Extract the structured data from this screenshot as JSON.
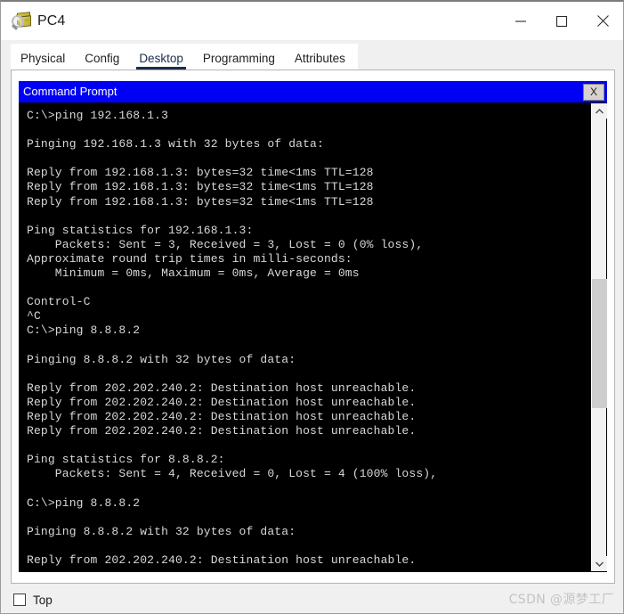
{
  "window": {
    "title": "PC4",
    "icon": "packet-tracer-magnifier-icon",
    "controls": {
      "minimize": "minimize-icon",
      "maximize": "maximize-icon",
      "close": "close-icon"
    }
  },
  "tabs": [
    {
      "label": "Physical",
      "active": false
    },
    {
      "label": "Config",
      "active": false
    },
    {
      "label": "Desktop",
      "active": true
    },
    {
      "label": "Programming",
      "active": false
    },
    {
      "label": "Attributes",
      "active": false
    }
  ],
  "command_prompt": {
    "title": "Command Prompt",
    "close_label": "X",
    "title_bar_color": "#0000f5",
    "background_color": "#000000",
    "text_color": "#d8d8d8",
    "lines": [
      "C:\\>ping 192.168.1.3",
      "",
      "Pinging 192.168.1.3 with 32 bytes of data:",
      "",
      "Reply from 192.168.1.3: bytes=32 time<1ms TTL=128",
      "Reply from 192.168.1.3: bytes=32 time<1ms TTL=128",
      "Reply from 192.168.1.3: bytes=32 time<1ms TTL=128",
      "",
      "Ping statistics for 192.168.1.3:",
      "    Packets: Sent = 3, Received = 3, Lost = 0 (0% loss),",
      "Approximate round trip times in milli-seconds:",
      "    Minimum = 0ms, Maximum = 0ms, Average = 0ms",
      "",
      "Control-C",
      "^C",
      "C:\\>ping 8.8.8.2",
      "",
      "Pinging 8.8.8.2 with 32 bytes of data:",
      "",
      "Reply from 202.202.240.2: Destination host unreachable.",
      "Reply from 202.202.240.2: Destination host unreachable.",
      "Reply from 202.202.240.2: Destination host unreachable.",
      "Reply from 202.202.240.2: Destination host unreachable.",
      "",
      "Ping statistics for 8.8.8.2:",
      "    Packets: Sent = 4, Received = 0, Lost = 4 (100% loss),",
      "",
      "C:\\>ping 8.8.8.2",
      "",
      "Pinging 8.8.8.2 with 32 bytes of data:",
      "",
      "Reply from 202.202.240.2: Destination host unreachable."
    ],
    "scrollbar": {
      "up_arrow": "chevron-up-icon",
      "down_arrow": "chevron-down-icon"
    }
  },
  "bottom": {
    "top_checkbox_label": "Top",
    "top_checkbox_checked": false
  },
  "watermark": "CSDN @源梦工厂"
}
